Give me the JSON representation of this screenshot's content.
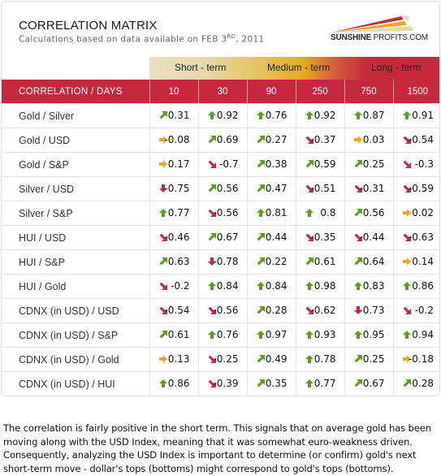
{
  "header": {
    "title": "CORRELATION MATRIX",
    "subtitle_prefix": "Calculations based on data available on  FEB 3",
    "subtitle_sup": "RD",
    "subtitle_suffix": ", 2011",
    "logo_bold": "SUNSHINE",
    "logo_rest": " PROFITS.COM"
  },
  "terms": {
    "short": "Short - term",
    "medium": "Medium - term",
    "long": "Long - term"
  },
  "colors": {
    "header_red": "#c4293d",
    "up": "#5a9e1c",
    "neutral": "#e6aa1e",
    "down": "#c4293d"
  },
  "table": {
    "corner_label": "CORRELATION / DAYS",
    "columns": [
      "10",
      "30",
      "90",
      "250",
      "750",
      "1500"
    ],
    "rows": [
      {
        "label": "Gold / Silver",
        "cells": [
          {
            "v": "0.31",
            "t": "upright"
          },
          {
            "v": "0.92",
            "t": "up"
          },
          {
            "v": "0.76",
            "t": "up"
          },
          {
            "v": "0.92",
            "t": "up"
          },
          {
            "v": "0.87",
            "t": "up"
          },
          {
            "v": "0.91",
            "t": "up"
          }
        ]
      },
      {
        "label": "Gold / USD",
        "cells": [
          {
            "v": "-0.08",
            "t": "right"
          },
          {
            "v": "0.69",
            "t": "upright"
          },
          {
            "v": "0.27",
            "t": "upright"
          },
          {
            "v": "-0.37",
            "t": "downright"
          },
          {
            "v": "0.03",
            "t": "right"
          },
          {
            "v": "-0.54",
            "t": "downright"
          }
        ]
      },
      {
        "label": "Gold / S&P",
        "cells": [
          {
            "v": "0.17",
            "t": "right"
          },
          {
            "v": "-0.7",
            "t": "downright"
          },
          {
            "v": "0.38",
            "t": "upright"
          },
          {
            "v": "0.59",
            "t": "upright"
          },
          {
            "v": "0.25",
            "t": "upright"
          },
          {
            "v": "-0.3",
            "t": "downright"
          }
        ]
      },
      {
        "label": "Silver / USD",
        "cells": [
          {
            "v": "-0.75",
            "t": "down"
          },
          {
            "v": "0.56",
            "t": "upright"
          },
          {
            "v": "0.47",
            "t": "upright"
          },
          {
            "v": "-0.51",
            "t": "downright"
          },
          {
            "v": "-0.31",
            "t": "downright"
          },
          {
            "v": "-0.59",
            "t": "downright"
          }
        ]
      },
      {
        "label": "Silver / S&P",
        "cells": [
          {
            "v": "0.77",
            "t": "up"
          },
          {
            "v": "-0.56",
            "t": "downright"
          },
          {
            "v": "0.81",
            "t": "up"
          },
          {
            "v": "0.8",
            "t": "up"
          },
          {
            "v": "0.56",
            "t": "upright"
          },
          {
            "v": "0.02",
            "t": "right"
          }
        ]
      },
      {
        "label": "HUI / USD",
        "cells": [
          {
            "v": "-0.46",
            "t": "downright"
          },
          {
            "v": "0.67",
            "t": "upright"
          },
          {
            "v": "0.44",
            "t": "upright"
          },
          {
            "v": "-0.35",
            "t": "downright"
          },
          {
            "v": "-0.44",
            "t": "downright"
          },
          {
            "v": "-0.63",
            "t": "downright"
          }
        ]
      },
      {
        "label": "HUI / S&P",
        "cells": [
          {
            "v": "0.63",
            "t": "upright"
          },
          {
            "v": "-0.78",
            "t": "down"
          },
          {
            "v": "0.22",
            "t": "upright"
          },
          {
            "v": "0.61",
            "t": "upright"
          },
          {
            "v": "0.64",
            "t": "upright"
          },
          {
            "v": "0.14",
            "t": "right"
          }
        ]
      },
      {
        "label": "HUI / Gold",
        "cells": [
          {
            "v": "-0.2",
            "t": "downright"
          },
          {
            "v": "0.84",
            "t": "up"
          },
          {
            "v": "0.84",
            "t": "up"
          },
          {
            "v": "0.98",
            "t": "up"
          },
          {
            "v": "0.83",
            "t": "up"
          },
          {
            "v": "0.86",
            "t": "up"
          }
        ]
      },
      {
        "label": "CDNX (in USD) / USD",
        "cells": [
          {
            "v": "-0.54",
            "t": "downright"
          },
          {
            "v": "-0.56",
            "t": "downright"
          },
          {
            "v": "0.28",
            "t": "upright"
          },
          {
            "v": "-0.62",
            "t": "downright"
          },
          {
            "v": "-0.73",
            "t": "down"
          },
          {
            "v": "-0.2",
            "t": "downright"
          }
        ]
      },
      {
        "label": "CDNX (in USD) / S&P",
        "cells": [
          {
            "v": "0.61",
            "t": "upright"
          },
          {
            "v": "0.76",
            "t": "up"
          },
          {
            "v": "0.97",
            "t": "up"
          },
          {
            "v": "0.93",
            "t": "up"
          },
          {
            "v": "0.95",
            "t": "up"
          },
          {
            "v": "0.94",
            "t": "up"
          }
        ]
      },
      {
        "label": "CDNX (in USD) / Gold",
        "cells": [
          {
            "v": "0.13",
            "t": "right"
          },
          {
            "v": "-0.25",
            "t": "downright"
          },
          {
            "v": "0.49",
            "t": "upright"
          },
          {
            "v": "0.78",
            "t": "up"
          },
          {
            "v": "0.25",
            "t": "upright"
          },
          {
            "v": "-0.18",
            "t": "right"
          }
        ]
      },
      {
        "label": "CDNX (in USD) / HUI",
        "cells": [
          {
            "v": "0.86",
            "t": "up"
          },
          {
            "v": "-0.39",
            "t": "downright"
          },
          {
            "v": "0.35",
            "t": "upright"
          },
          {
            "v": "0.77",
            "t": "up"
          },
          {
            "v": "0.67",
            "t": "upright"
          },
          {
            "v": "0.28",
            "t": "upright"
          }
        ]
      }
    ]
  },
  "description": "The correlation is fairly positive in the short term. This signals that on average gold has been moving along with the USD Index, meaning that it was somewhat euro-weakness driven. Consequently, analyzing the USD Index is important to determine (or confirm) gold's next short-term move - dollar's tops (bottoms) might correspond to gold's tops (bottoms)."
}
